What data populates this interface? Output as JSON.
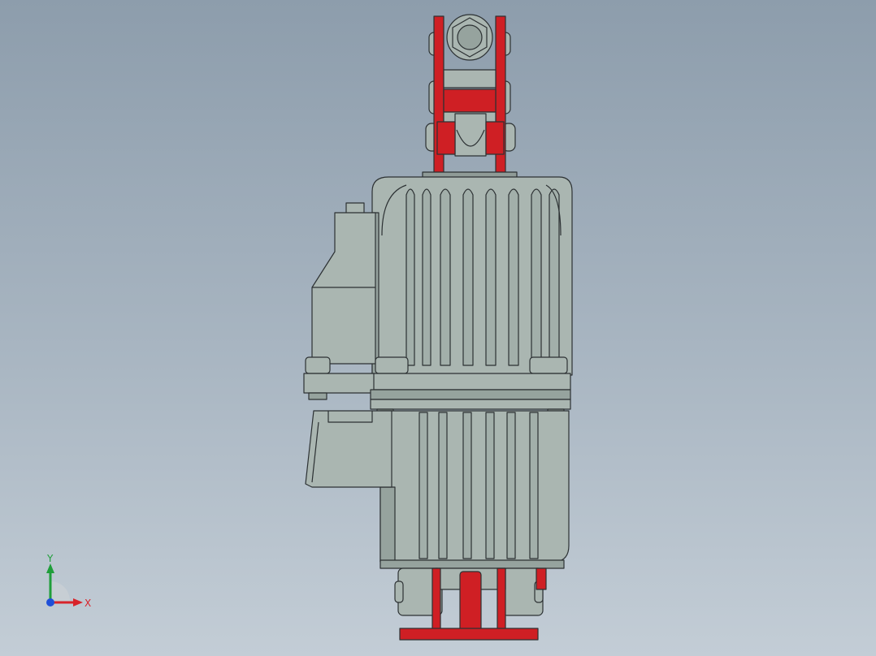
{
  "viewport": {
    "background_top": "#8d9dac",
    "background_bottom": "#c3cdd6"
  },
  "model": {
    "body_color": "#aab6b1",
    "body_shade": "#96a39e",
    "accent_color": "#cf1f24",
    "edge_color": "#2c3133"
  },
  "triad": {
    "x_label": "X",
    "y_label": "Y",
    "x_color": "#d8232a",
    "y_color": "#1f9e3a",
    "z_color": "#1f4fd8"
  }
}
